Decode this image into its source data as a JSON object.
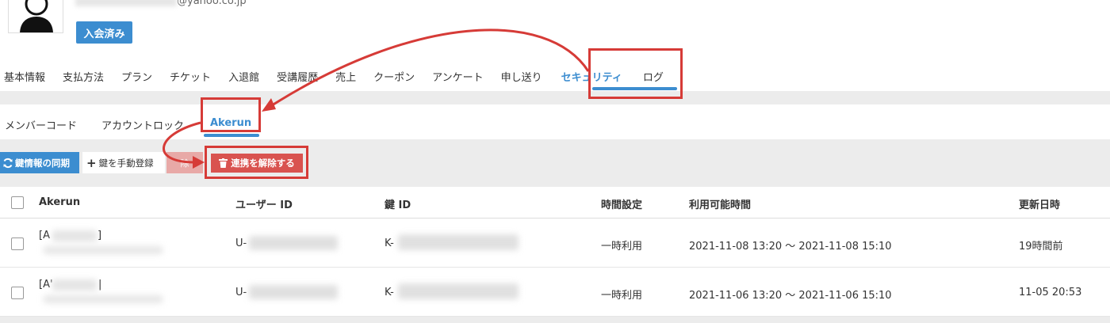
{
  "profile": {
    "email_suffix": "@yahoo.co.jp",
    "status_badge": "入会済み"
  },
  "main_tabs": [
    "基本情報",
    "支払方法",
    "プラン",
    "チケット",
    "入退館",
    "受講履歴",
    "売上",
    "クーポン",
    "アンケート",
    "申し送り",
    "セキュリティ",
    "ログ"
  ],
  "main_tab_active": "セキュリティ",
  "sub_tabs": [
    "メンバーコード",
    "アカウントロック",
    "Akerun"
  ],
  "sub_tab_active": "Akerun",
  "actions": {
    "sync": "鍵情報の同期",
    "manual": "鍵を手動登録",
    "delete_partial": "除",
    "unlink": "連携を解除する"
  },
  "table": {
    "columns": [
      "Akerun",
      "ユーザー ID",
      "鍵 ID",
      "時間設定",
      "利用可能時間",
      "更新日時"
    ],
    "rows": [
      {
        "akerun": "[A",
        "akerun_end": "]",
        "user_id": "U-",
        "key_id": "K-",
        "time_setting": "一時利用",
        "available": "2021-11-08 13:20 〜 2021-11-08 15:10",
        "updated": "19時間前"
      },
      {
        "akerun": "[A'",
        "akerun_end": "|",
        "user_id": "U-",
        "key_id": "K-",
        "time_setting": "一時利用",
        "available": "2021-11-06 13:20 〜 2021-11-06 15:10",
        "updated": "11-05 20:53"
      }
    ]
  },
  "colors": {
    "accent": "#3c8dd0",
    "danger": "#d9534f",
    "annotation": "#d63b37"
  }
}
